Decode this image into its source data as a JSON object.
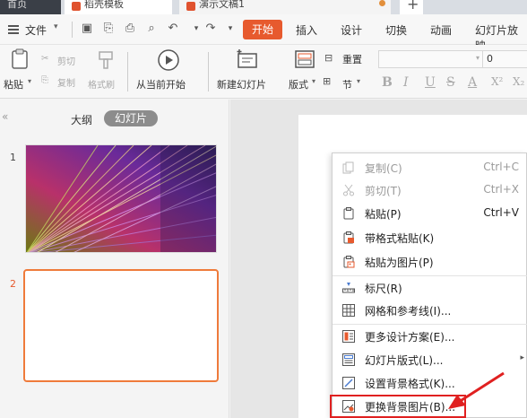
{
  "tabs": {
    "home": "首页",
    "template": "稻壳模板",
    "document": "演示文稿1",
    "plus": "+"
  },
  "menu": {
    "file": "文件",
    "start": "开始",
    "insert": "插入",
    "design": "设计",
    "transition": "切换",
    "animation": "动画",
    "slideshow": "幻灯片放映"
  },
  "ribbon": {
    "paste": "粘贴",
    "cut": "剪切",
    "copy": "复制",
    "format_painter": "格式刷",
    "play_from_current": "从当前开始",
    "new_slide": "新建幻灯片",
    "layout": "版式",
    "section": "节",
    "reset": "重置",
    "font_size": "0",
    "format_buttons": [
      "B",
      "I",
      "U",
      "S",
      "A",
      "X²",
      "X₂"
    ]
  },
  "panel": {
    "outline_tab": "大纲",
    "slides_tab": "幻灯片",
    "slide1_number": "1",
    "slide2_number": "2"
  },
  "context_menu": {
    "items": [
      {
        "label": "复制(C)",
        "shortcut": "Ctrl+C",
        "disabled": true,
        "icon": "copy-icon"
      },
      {
        "label": "剪切(T)",
        "shortcut": "Ctrl+X",
        "disabled": true,
        "icon": "scissors-icon"
      },
      {
        "label": "粘贴(P)",
        "shortcut": "Ctrl+V",
        "disabled": false,
        "icon": "clipboard-icon"
      },
      {
        "label": "带格式粘贴(K)",
        "shortcut": "",
        "disabled": false,
        "icon": "paste-formatted-icon"
      },
      {
        "label": "粘贴为图片(P)",
        "shortcut": "",
        "disabled": false,
        "icon": "paste-image-icon"
      },
      {
        "label": "标尺(R)",
        "shortcut": "",
        "disabled": false,
        "icon": "ruler-icon"
      },
      {
        "label": "网格和参考线(I)...",
        "shortcut": "",
        "disabled": false,
        "icon": "grid-icon"
      },
      {
        "label": "更多设计方案(E)...",
        "shortcut": "",
        "disabled": false,
        "icon": "design-icon"
      },
      {
        "label": "幻灯片版式(L)...",
        "shortcut": "",
        "disabled": false,
        "icon": "layout-icon"
      },
      {
        "label": "设置背景格式(K)...",
        "shortcut": "",
        "disabled": false,
        "icon": "background-format-icon"
      },
      {
        "label": "更换背景图片(B)...",
        "shortcut": "",
        "disabled": false,
        "icon": "change-background-icon"
      }
    ]
  },
  "colors": {
    "accent": "#e75a2e",
    "highlight": "#e02020",
    "selected_thumb": "#ef7b3b"
  }
}
